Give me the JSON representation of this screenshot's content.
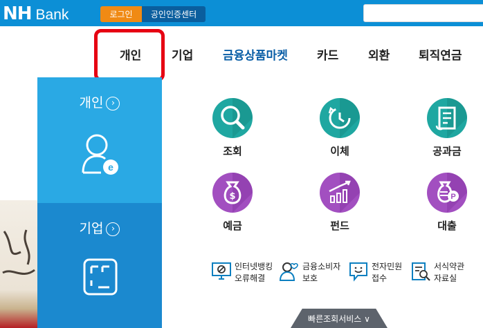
{
  "header": {
    "logo_nh": "NH",
    "logo_bank": "Bank",
    "login_label": "로그인",
    "cert_label": "공인인증센터",
    "search": {
      "value": ""
    }
  },
  "nav": {
    "items": [
      "개인",
      "기업",
      "금융상품마켓",
      "카드",
      "외환",
      "퇴직연금"
    ],
    "active": "개인",
    "highlight_color": "#e60012",
    "accent_color": "#0a5ea6"
  },
  "side": {
    "personal_label": "개인",
    "corporate_label": "기업",
    "personal_icon": "person-e-icon",
    "corporate_icon": "building-frame-icon",
    "colors": {
      "personal": "#2aa9e4",
      "corporate": "#1b89cf"
    }
  },
  "services": [
    {
      "label": "조회",
      "icon": "magnifier-icon",
      "color": "#1fa7a1"
    },
    {
      "label": "이체",
      "icon": "clock-transfer-icon",
      "color": "#1fa7a1"
    },
    {
      "label": "공과금",
      "icon": "receipt-icon",
      "color": "#1fa7a1"
    },
    {
      "label": "예금",
      "icon": "money-bag-icon",
      "color": "#a24fc0"
    },
    {
      "label": "펀드",
      "icon": "growth-chart-icon",
      "color": "#a24fc0"
    },
    {
      "label": "대출",
      "icon": "coin-bag-icon",
      "color": "#a24fc0"
    }
  ],
  "links": [
    {
      "line1": "인터넷뱅킹",
      "line2": "오류해결",
      "icon": "monitor-block-icon"
    },
    {
      "line1": "금융소비자",
      "line2": "보호",
      "icon": "person-heart-icon"
    },
    {
      "line1": "전자민원",
      "line2": "접수",
      "icon": "chat-smile-icon"
    },
    {
      "line1": "서식약관",
      "line2": "자료실",
      "icon": "document-search-icon"
    }
  ],
  "quick_service": "빠른조회서비스 ∨"
}
